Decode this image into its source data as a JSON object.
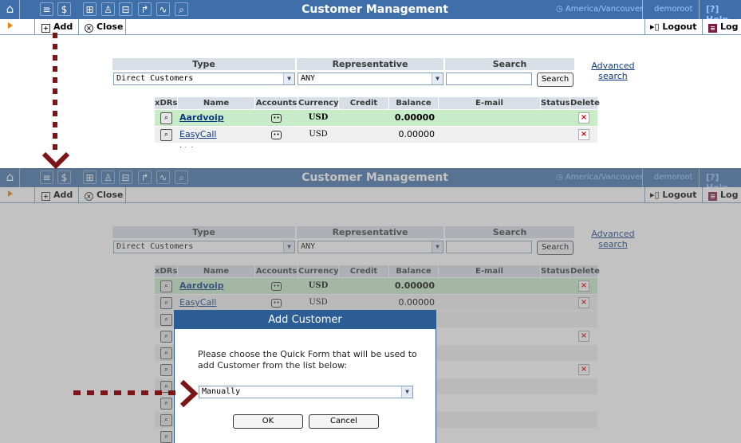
{
  "app": {
    "title": "Customer Management",
    "timezone": "America/Vancouver",
    "user": "demoroot",
    "help": "Help"
  },
  "toolbar": {
    "add": "Add",
    "close": "Close",
    "logout": "Logout",
    "log": "Log"
  },
  "filter": {
    "type_header": "Type",
    "rep_header": "Representative",
    "search_header": "Search",
    "type_value": "Direct Customers",
    "rep_value": "ANY",
    "search_value": "",
    "search_button": "Search",
    "advanced_line1": "Advanced",
    "advanced_line2": "search"
  },
  "table": {
    "columns": [
      "xDRs",
      "Name",
      "Accounts",
      "Currency",
      "Credit Limit",
      "Balance",
      "E-mail",
      "Status",
      "Delete"
    ],
    "rows": [
      {
        "name": "Aardvoip",
        "currency": "USD",
        "credit_limit": "",
        "balance": "0.00000",
        "email": "",
        "status": ""
      },
      {
        "name": "EasyCall Ltd.",
        "currency": "USD",
        "credit_limit": "",
        "balance": "0.00000",
        "email": "",
        "status": ""
      }
    ]
  },
  "modal": {
    "title": "Add Customer",
    "text": "Please choose the Quick Form that will be used to add Customer from the list below:",
    "selected": "Manually",
    "ok": "OK",
    "cancel": "Cancel"
  },
  "colors": {
    "titlebar": "#3f6fa8",
    "row_highlight": "#c8ebc8",
    "annotation": "#7b1518",
    "modal_header": "#2c5d95"
  },
  "icons": [
    "home-icon",
    "list-icon",
    "dollar-icon",
    "grid-icon",
    "person-icon",
    "tree-icon",
    "import-icon",
    "chart-icon",
    "search-icon",
    "add-icon",
    "close-icon",
    "logout-icon",
    "log-icon",
    "zoom-icon",
    "accounts-icon",
    "delete-icon",
    "clock-icon",
    "help-icon",
    "dropdown-arrow-icon"
  ]
}
